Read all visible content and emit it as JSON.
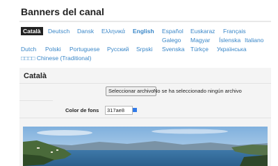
{
  "page": {
    "title": "Banners del canal"
  },
  "languages": {
    "rows": [
      [
        {
          "label": "Català",
          "state": "active"
        },
        {
          "label": "Deutsch"
        },
        {
          "label": "Dansk"
        },
        {
          "label": "Ελληνικά"
        },
        {
          "label": "English",
          "state": "bold"
        },
        {
          "label": "Español"
        },
        {
          "label": "Euskaraz"
        },
        {
          "label": "Français"
        }
      ],
      [
        {
          "label": "Galego"
        },
        {
          "label": "Magyar"
        },
        {
          "label": "Íslenska"
        },
        {
          "label": "Italiano"
        }
      ],
      [
        {
          "label": "Dutch"
        },
        {
          "label": "Polski"
        },
        {
          "label": "Portuguese"
        },
        {
          "label": "Русский"
        },
        {
          "label": "Srpski"
        },
        {
          "label": "Svenska"
        },
        {
          "label": "Türkçe"
        },
        {
          "label": "Українська"
        }
      ],
      [
        {
          "label": "□□□□ Chinese (Traditional)"
        }
      ]
    ]
  },
  "panel": {
    "title": "Català",
    "file_button": "Seleccionar archivo",
    "file_status": "No se ha seleccionado ningún archivo",
    "color_label": "Color de fons",
    "color_value": "317ae8",
    "color_hex": "#317ae8"
  },
  "colors": {
    "link": "#3a87c8",
    "active_bg": "#222222"
  }
}
